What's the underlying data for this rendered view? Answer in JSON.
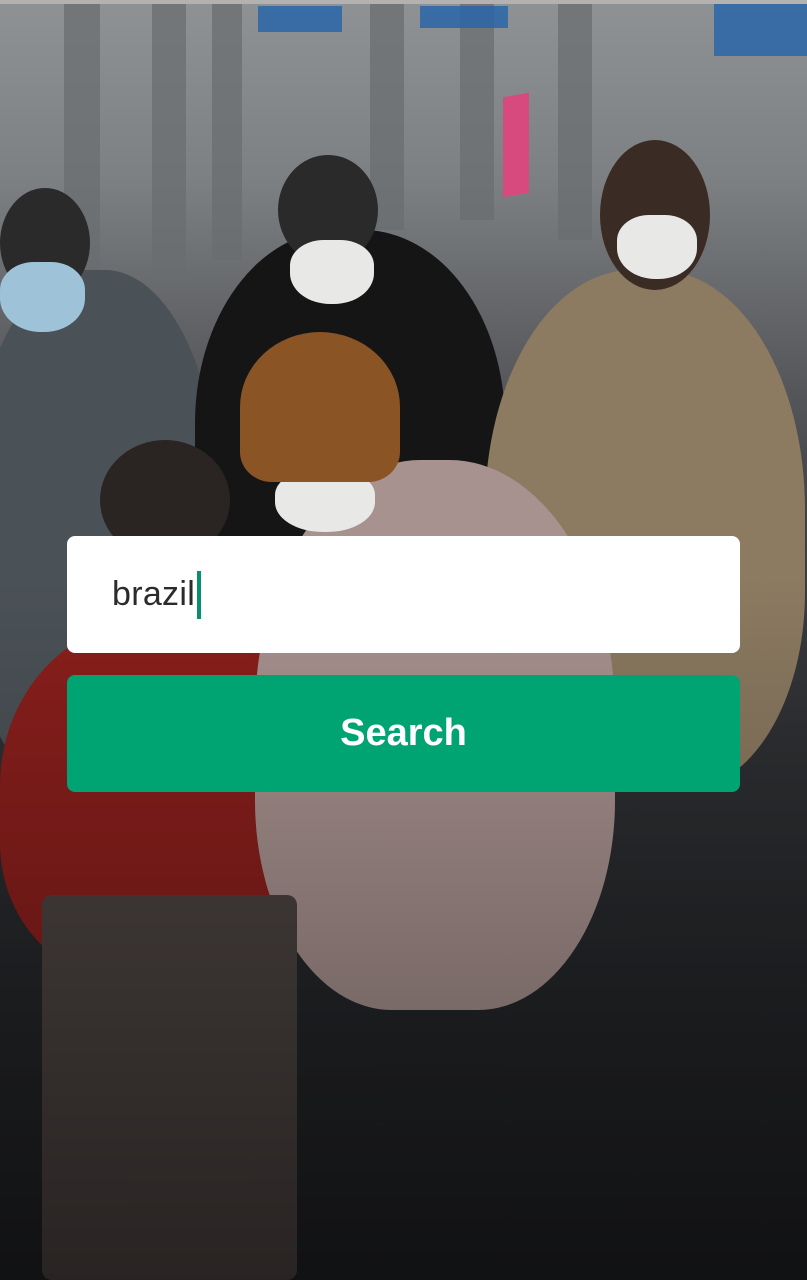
{
  "background": {
    "image_name": "crowd-wearing-masks-photo"
  },
  "search": {
    "value": "brazil",
    "button_label": "Search"
  },
  "colors": {
    "accent": "#00a473",
    "caret": "#0a8e6d",
    "input_bg": "#ffffff"
  }
}
